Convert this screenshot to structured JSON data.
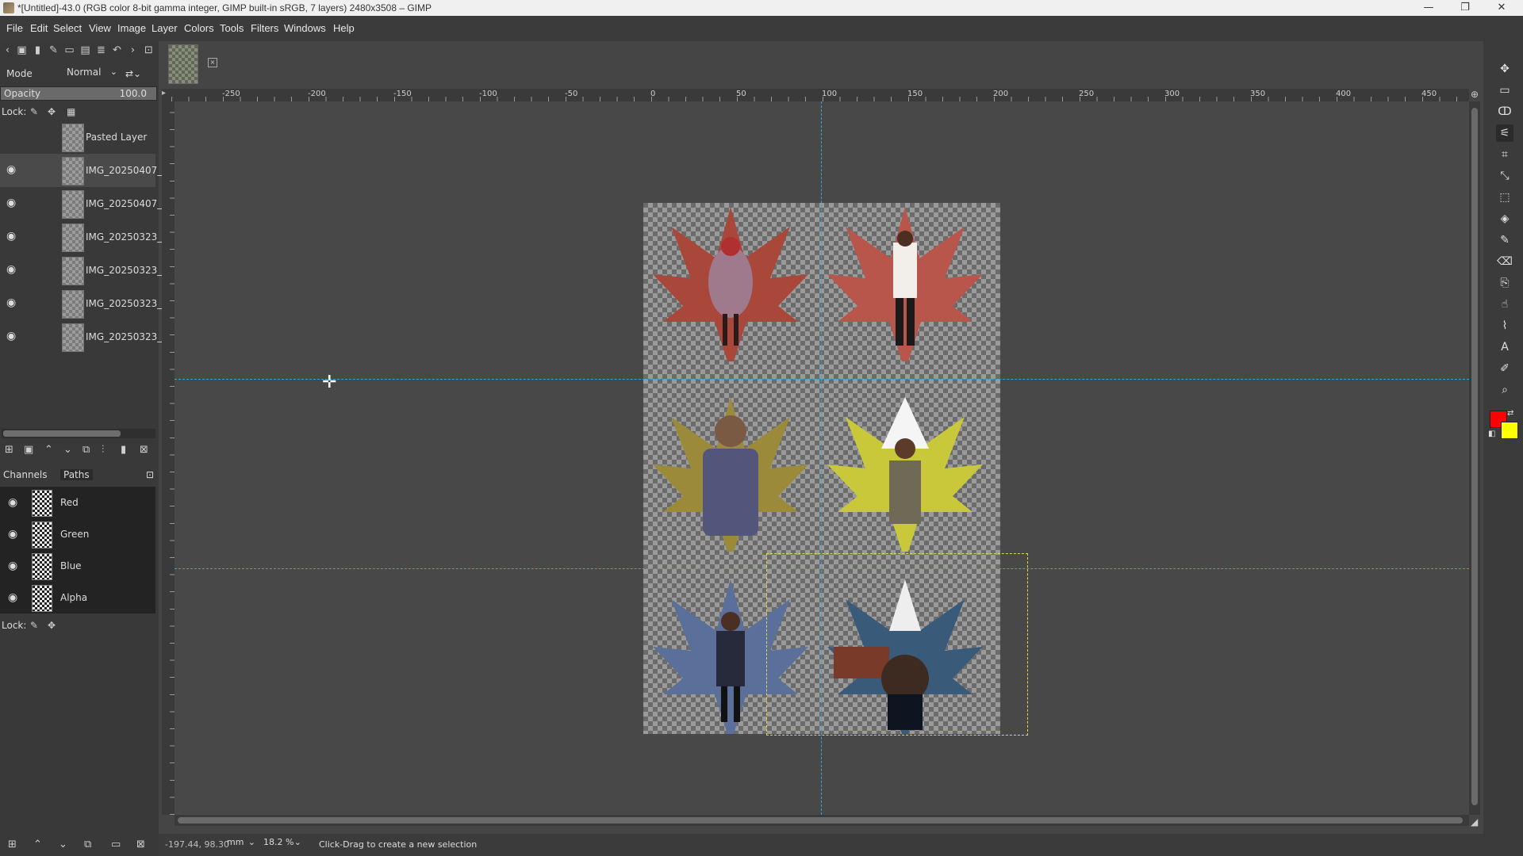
{
  "window": {
    "title": "*[Untitled]-43.0 (RGB color 8-bit gamma integer, GIMP built-in sRGB, 7 layers) 2480x3508 – GIMP",
    "minimize": "—",
    "maximize": "❐",
    "close": "✕"
  },
  "menu": [
    "File",
    "Edit",
    "Select",
    "View",
    "Image",
    "Layer",
    "Colors",
    "Tools",
    "Filters",
    "Windows",
    "Help"
  ],
  "layers_panel": {
    "mode_label": "Mode",
    "mode_value": "Normal",
    "opacity_label": "Opacity",
    "opacity_value": "100.0",
    "opacity_fraction": 1.0,
    "lock_label": "Lock:",
    "layers": [
      {
        "name": "Pasted Layer",
        "visible": false,
        "active": false
      },
      {
        "name": "IMG_20250407_",
        "visible": true,
        "active": true
      },
      {
        "name": "IMG_20250407_",
        "visible": true,
        "active": false
      },
      {
        "name": "IMG_20250323_",
        "visible": true,
        "active": false
      },
      {
        "name": "IMG_20250323_",
        "visible": true,
        "active": false
      },
      {
        "name": "IMG_20250323_",
        "visible": true,
        "active": false
      },
      {
        "name": "IMG_20250323_",
        "visible": true,
        "active": false
      }
    ]
  },
  "channels_panel": {
    "tab_channels": "Channels",
    "tab_paths": "Paths",
    "channels": [
      "Red",
      "Green",
      "Blue",
      "Alpha"
    ],
    "lock_label": "Lock:"
  },
  "ruler": {
    "labels": [
      "-250",
      "-200",
      "-150",
      "-100",
      "-50",
      "0",
      "50",
      "100",
      "150",
      "200",
      "250",
      "300",
      "350",
      "400",
      "450"
    ]
  },
  "colors": {
    "foreground": "#ff0000",
    "background": "#ffff00",
    "guides": "#2aa8d8",
    "selection": "#e3d84a"
  },
  "tools": [
    "move-icon",
    "rect-select-icon",
    "lasso-icon",
    "fuzzy-select-icon",
    "crop-icon",
    "scale-icon",
    "transform-icon",
    "bucket-fill-icon",
    "paintbrush-icon",
    "eraser-icon",
    "clone-icon",
    "smudge-icon",
    "paths-icon",
    "text-icon",
    "color-picker-icon",
    "zoom-icon"
  ],
  "status": {
    "coords": "-197.44, 98.30",
    "unit": "mm",
    "zoom": "18.2 %",
    "message": "Click-Drag to create a new selection"
  }
}
